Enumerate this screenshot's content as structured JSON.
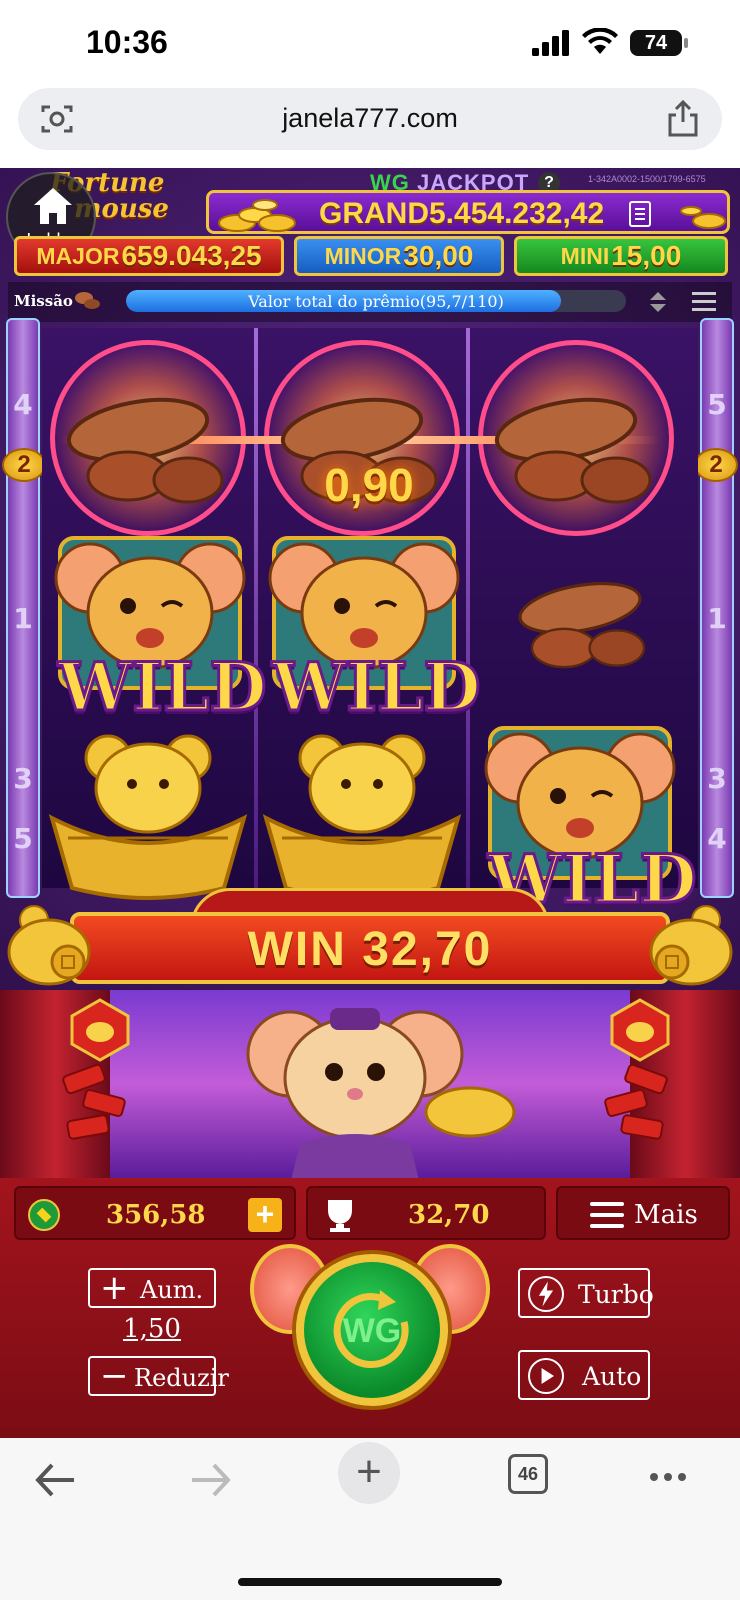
{
  "status_bar": {
    "time": "10:36",
    "battery": "74"
  },
  "browser": {
    "url": "janela777.com",
    "tab_count": "46"
  },
  "game": {
    "lobby_label": "Lobby",
    "logo_line1": "Fortune",
    "logo_line2": "mouse",
    "jackpot_title_wg": "WG",
    "jackpot_title_jp": "JACKPOT",
    "jackpot_help": "?",
    "jackpot_id": "1-342A0002-1500/1799-6575",
    "grand_label": "GRAND",
    "grand_value": "5.454.232,42",
    "major_label": "MAJOR",
    "major_value": "659.043,25",
    "minor_label": "MINOR",
    "minor_value": "30,00",
    "mini_label": "MINI",
    "mini_value": "15,00",
    "mission_label": "Missão",
    "mission_progress_text": "Valor total do prêmio(95,7/110)",
    "mission_progress_fraction": 0.87,
    "side_left_numbers": [
      "4",
      "2",
      "1",
      "3",
      "5"
    ],
    "side_right_numbers": [
      "5",
      "2",
      "1",
      "3",
      "4"
    ],
    "reels": [
      [
        "peanut",
        "wild",
        "gold-ingot"
      ],
      [
        "peanut",
        "wild",
        "gold-ingot"
      ],
      [
        "peanut",
        "peanut",
        "wild"
      ]
    ],
    "wild_text": "WILD",
    "line_win": "0,90",
    "win_banner": "WIN 32,70"
  },
  "panel": {
    "balance": "356,58",
    "plus": "+",
    "win": "32,70",
    "more_label": "Mais",
    "increase_label": "Aum.",
    "bet_value": "1,50",
    "decrease_label": "Reduzir",
    "turbo_label": "Turbo",
    "auto_label": "Auto",
    "spin_logo": "WG"
  },
  "colors": {
    "accent_gold": "#f1c53b",
    "panel_red": "#a3141d",
    "spin_green": "#0b8a2a"
  }
}
